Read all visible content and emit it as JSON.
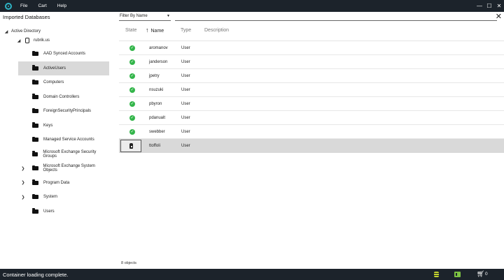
{
  "menu": [
    "File",
    "Cart",
    "Help"
  ],
  "window_controls": [
    "—",
    "☐",
    "✕"
  ],
  "left_pane": {
    "title": "Imported Databases",
    "tree": {
      "root": "Active Directory",
      "domain": "rubrik.us",
      "items": [
        {
          "label": "AAD Synced Accounts",
          "expandable": false,
          "selected": false
        },
        {
          "label": "ActiveUsers",
          "expandable": false,
          "selected": true
        },
        {
          "label": "Computers",
          "expandable": false,
          "selected": false
        },
        {
          "label": "Domain Controllers",
          "expandable": false,
          "selected": false
        },
        {
          "label": "ForeignSecurityPrincipals",
          "expandable": false,
          "selected": false
        },
        {
          "label": "Keys",
          "expandable": false,
          "selected": false
        },
        {
          "label": "Managed Service Accounts",
          "expandable": false,
          "selected": false
        },
        {
          "label": "Microsoft Exchange Security Groups",
          "expandable": false,
          "selected": false
        },
        {
          "label": "Microsoft Exchange System Objects",
          "expandable": true,
          "selected": false
        },
        {
          "label": "Program Data",
          "expandable": true,
          "selected": false
        },
        {
          "label": "System",
          "expandable": true,
          "selected": false
        },
        {
          "label": "Users",
          "expandable": false,
          "selected": false
        }
      ]
    }
  },
  "filter": {
    "select_value": "Filter By Name",
    "input_value": "",
    "input_placeholder": ""
  },
  "table": {
    "columns": {
      "state": "State",
      "name": "Name",
      "type": "Type",
      "description": "Description"
    },
    "rows": [
      {
        "state": "ok",
        "name": "aromanov",
        "type": "User",
        "description": "",
        "selected": false
      },
      {
        "state": "ok",
        "name": "janderson",
        "type": "User",
        "description": "",
        "selected": false
      },
      {
        "state": "ok",
        "name": "jpetry",
        "type": "User",
        "description": "",
        "selected": false
      },
      {
        "state": "ok",
        "name": "nsuzuki",
        "type": "User",
        "description": "",
        "selected": false
      },
      {
        "state": "ok",
        "name": "pbyron",
        "type": "User",
        "description": "",
        "selected": false
      },
      {
        "state": "ok",
        "name": "pdanualt",
        "type": "User",
        "description": "",
        "selected": false
      },
      {
        "state": "ok",
        "name": "swebber",
        "type": "User",
        "description": "",
        "selected": false
      },
      {
        "state": "locked",
        "name": "ttoffoli",
        "type": "User",
        "description": "",
        "selected": true
      }
    ],
    "count_label": "8 objects"
  },
  "status": {
    "message": "Container loading complete.",
    "cart_count": "0"
  },
  "colors": {
    "chrome": "#1c232b",
    "accent": "#2fb3c4",
    "ok": "#33b54a",
    "selected_row": "#d9d9d9"
  }
}
